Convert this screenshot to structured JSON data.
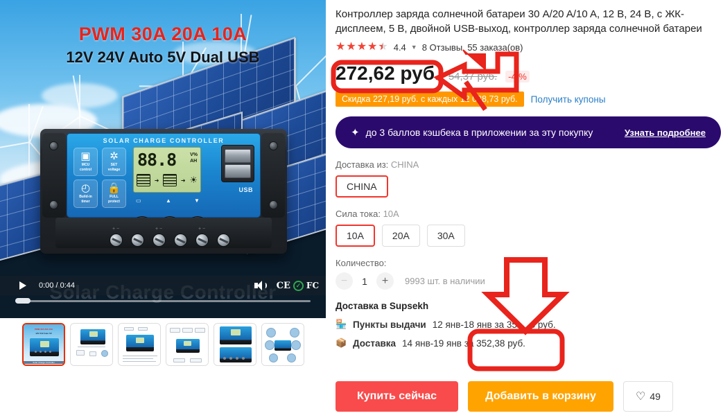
{
  "product": {
    "title": "Контроллер заряда солнечной батареи 30 A/20 A/10 A, 12 В, 24 В, с ЖК-дисплеем, 5 В, двойной USB-выход, контроллер заряда солнечной батареи",
    "rating_value": "4.4",
    "rating_percent": 88,
    "reviews": "8 Отзывы",
    "orders": "55 заказа(ов)"
  },
  "price": {
    "current": "272,62 руб.",
    "old": "54,37 руб.",
    "discount": "-4 %",
    "coupon": "Скидка 227,19 руб. с каждых 12 088,73 руб.",
    "coupon_link": "Получить купоны"
  },
  "cashback": {
    "icon": "coin-icon",
    "text": "до 3 баллов кэшбека в приложении за эту покупку",
    "link": "Узнать подробнее"
  },
  "options": {
    "ship_from_label": "Доставка из:",
    "ship_from_value": "CHINA",
    "ship_from_chips": [
      "CHINA"
    ],
    "current_label": "Сила тока:",
    "current_value": "10A",
    "current_chips": [
      "10A",
      "20A",
      "30A"
    ]
  },
  "quantity": {
    "label": "Количество:",
    "minus": "−",
    "value": "1",
    "plus": "+",
    "stock": "9993 шт. в наличии"
  },
  "shipping": {
    "title": "Доставка в Supsekh",
    "rows": [
      {
        "icon": "pickup-point-icon",
        "name": "Пункты выдачи",
        "detail": "12 янв-18 янв за 352,38 руб."
      },
      {
        "icon": "package-icon",
        "name": "Доставка",
        "detail": "14 янв-19 янв за 352,38 руб."
      }
    ]
  },
  "actions": {
    "buy_now": "Купить сейчас",
    "add_to_cart": "Добавить в корзину",
    "wishlist_count": "49"
  },
  "gallery": {
    "headline_top": "PWM 30A 20A 10A",
    "headline_sub": "12V 24V Auto 5V Dual USB",
    "watermark": "Solar Charge Controller",
    "device": {
      "face_title": "SOLAR CHARGE CONTROLLER",
      "lcd_digits": "88.8",
      "lcd_units_top": "V%",
      "lcd_units_bottom": "AH",
      "usb_label": "USB",
      "features": [
        {
          "glyph": "▣",
          "line1": "MCU",
          "line2": "control"
        },
        {
          "glyph": "✲",
          "line1": "SET",
          "line2": "voltage"
        },
        {
          "glyph": "◴",
          "line1": "Build-in",
          "line2": "timer"
        },
        {
          "glyph": "🔒",
          "line1": "FULL",
          "line2": "protect"
        }
      ],
      "terminal_labels": [
        "+ −",
        "+ −",
        "+ −"
      ]
    },
    "video": {
      "play": "play-icon",
      "time": "0:00 / 0:44",
      "volume": "volume-icon",
      "cert_ce": "CE",
      "cert_tick": "✓",
      "cert_fc": "FC"
    },
    "thumbnails": [
      {
        "caption": "Solar Charge Controller",
        "selected": true
      },
      {
        "caption": "",
        "selected": false
      },
      {
        "caption": "",
        "selected": false
      },
      {
        "caption": "",
        "selected": false
      },
      {
        "caption": "",
        "selected": false
      },
      {
        "caption": "",
        "selected": false
      }
    ]
  },
  "colors": {
    "price": "#191919",
    "discount": "#f2352c",
    "coupon_bg": "#ff9800",
    "cashback_bg": "#2b0a6e",
    "buy_now_bg": "#f94b4b",
    "cart_bg": "#ffa300",
    "selected_border": "#f2352c",
    "annotation": "#e8241c"
  }
}
